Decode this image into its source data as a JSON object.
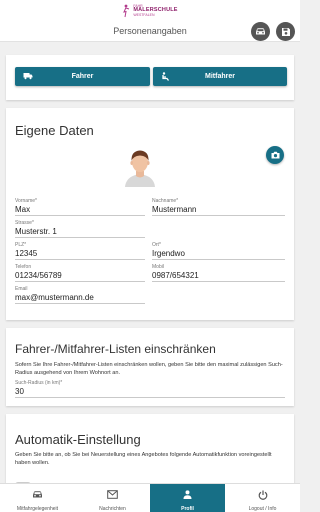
{
  "logo": {
    "small": "FAHR",
    "main": "MALERSCHULE",
    "sub": "WESTFALEN"
  },
  "header": {
    "title": "Personenangaben",
    "car_icon": "car-icon",
    "save_icon": "save-icon"
  },
  "role_switch": {
    "fahrer_label": "Fahrer",
    "mitfahrer_label": "Mitfahrer"
  },
  "eigene_daten": {
    "title": "Eigene Daten",
    "fields": {
      "vorname": {
        "label": "Vorname*",
        "value": "Max"
      },
      "nachname": {
        "label": "Nachname*",
        "value": "Mustermann"
      },
      "strasse": {
        "label": "Strasse*",
        "value": "Musterstr. 1"
      },
      "plz": {
        "label": "PLZ*",
        "value": "12345"
      },
      "ort": {
        "label": "Ort*",
        "value": "Irgendwo"
      },
      "telefon": {
        "label": "Telefon",
        "value": "01234/56789"
      },
      "mobil": {
        "label": "Mobil",
        "value": "0987/654321"
      },
      "email": {
        "label": "Email",
        "value": "max@mustermann.de"
      }
    }
  },
  "filter": {
    "title": "Fahrer-/Mitfahrer-Listen einschränken",
    "description": "Sofern Sie Ihre Fahrer-/Mitfahrer-Listen einschränken wollen, geben Sie bitte den maximal zulässigen Such-Radius ausgehend von Ihrem Wohnort an.",
    "radius_label": "Such-Radius (in km)*",
    "radius_value": "30"
  },
  "auto": {
    "title": "Automatik-Einstellung",
    "description": "Geben Sie bitte an, ob Sie bei Neuerstellung eines Angebotes folgende Automatikfunktion voreingestellt haben wollen."
  },
  "nav": {
    "items": [
      {
        "label": "Mitfahrgelegenheit",
        "icon": "car-icon"
      },
      {
        "label": "Nachrichten",
        "icon": "mail-icon"
      },
      {
        "label": "Profil",
        "icon": "person-icon"
      },
      {
        "label": "Logout / Info",
        "icon": "power-icon"
      }
    ]
  },
  "colors": {
    "accent": "#176f86",
    "header_button": "#555555",
    "brand": "#8e1f6a"
  }
}
